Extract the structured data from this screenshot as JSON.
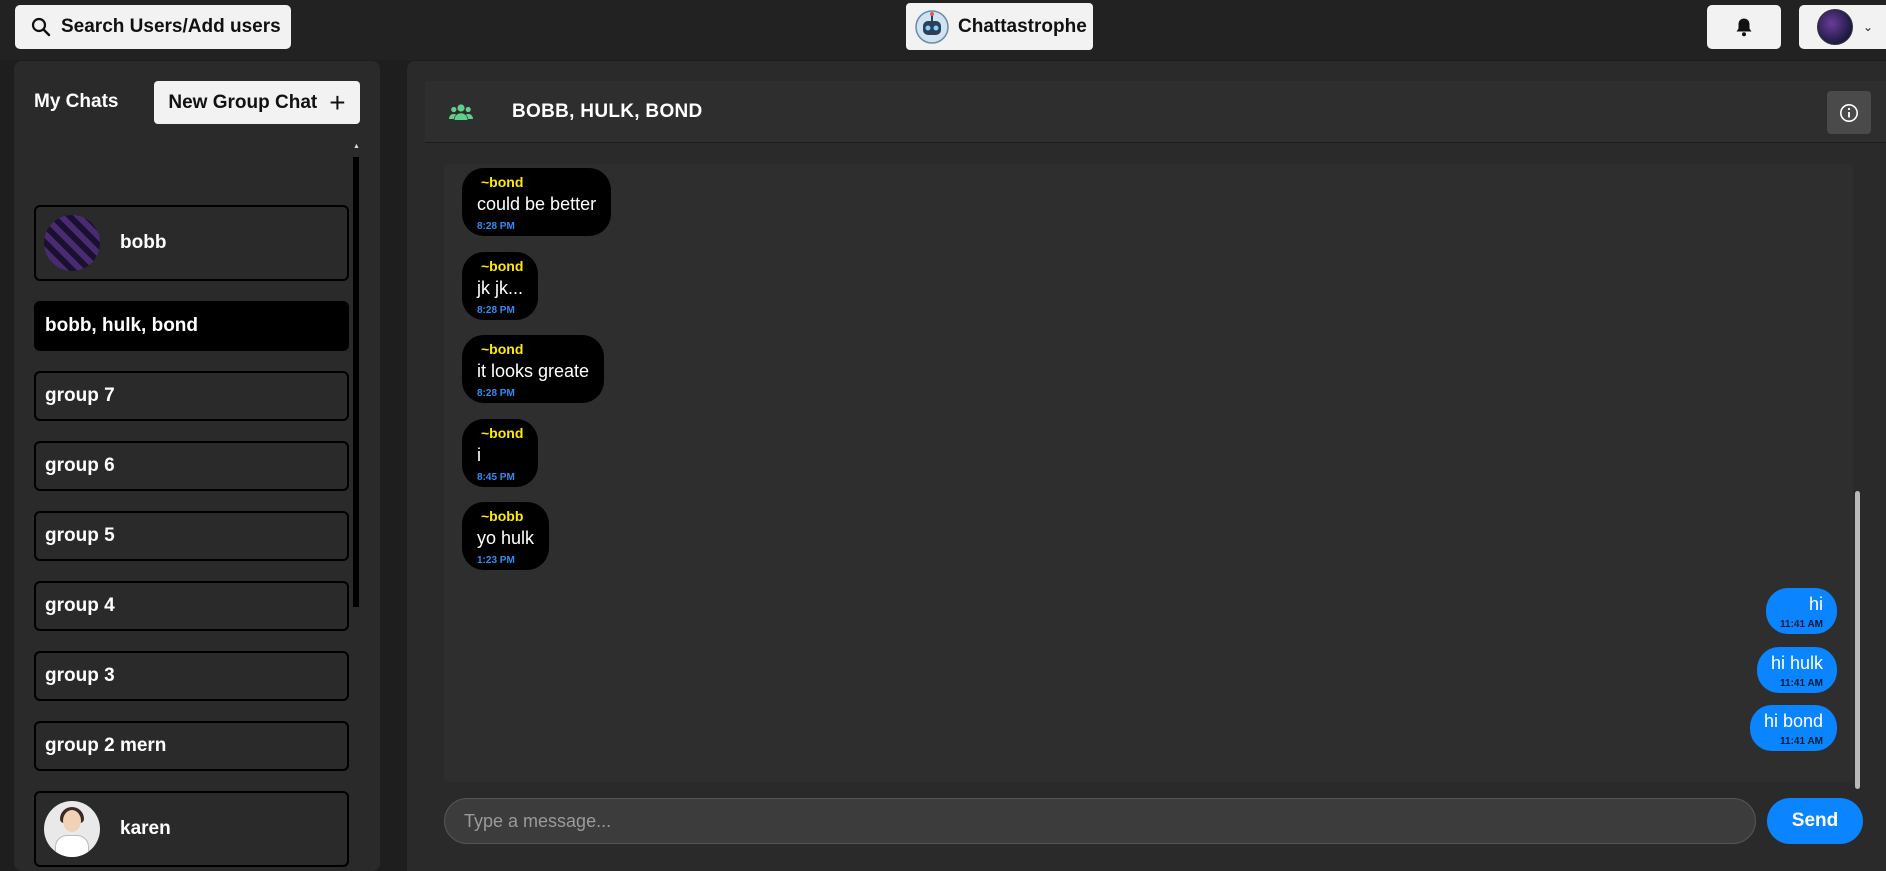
{
  "topbar": {
    "search_label": "Search Users/Add users",
    "brand_name": "Chattastrophe"
  },
  "sidebar": {
    "title": "My Chats",
    "new_group_label": "New Group Chat",
    "chats": [
      {
        "label": "bobb",
        "has_avatar": true
      },
      {
        "label": "bobb, hulk, bond",
        "active": true
      },
      {
        "label": "group 7"
      },
      {
        "label": "group 6"
      },
      {
        "label": "group 5"
      },
      {
        "label": "group 4"
      },
      {
        "label": "group 3"
      },
      {
        "label": "group 2 mern"
      },
      {
        "label": "karen",
        "has_avatar": true
      }
    ]
  },
  "chat": {
    "title": "BOBB, HULK, BOND",
    "messages": [
      {
        "sender": "~bond",
        "text": "could be better",
        "time": "8:28 PM",
        "mine": false
      },
      {
        "sender": "~bond",
        "text": "jk jk...",
        "time": "8:28 PM",
        "mine": false
      },
      {
        "sender": "~bond",
        "text": "it looks greate",
        "time": "8:28 PM",
        "mine": false
      },
      {
        "sender": "~bond",
        "text": "i",
        "time": "8:45 PM",
        "mine": false
      },
      {
        "sender": "~bobb",
        "text": "yo hulk",
        "time": "1:23 PM",
        "mine": false
      },
      {
        "text": "hi",
        "time": "11:41 AM",
        "mine": true
      },
      {
        "text": "hi hulk",
        "time": "11:41 AM",
        "mine": true
      },
      {
        "text": "hi bond",
        "time": "11:41 AM",
        "mine": true
      }
    ],
    "input_placeholder": "Type a message...",
    "input_value": "",
    "send_label": "Send"
  },
  "colors": {
    "accent": "#0a84ff",
    "sender_name": "#ffea00",
    "group_icon": "#5fd08a"
  },
  "icons": {
    "search": "search-icon",
    "bell": "bell-icon",
    "info": "info-icon",
    "group": "users-icon",
    "plus": "plus-icon",
    "chevron": "chevron-down-icon"
  }
}
